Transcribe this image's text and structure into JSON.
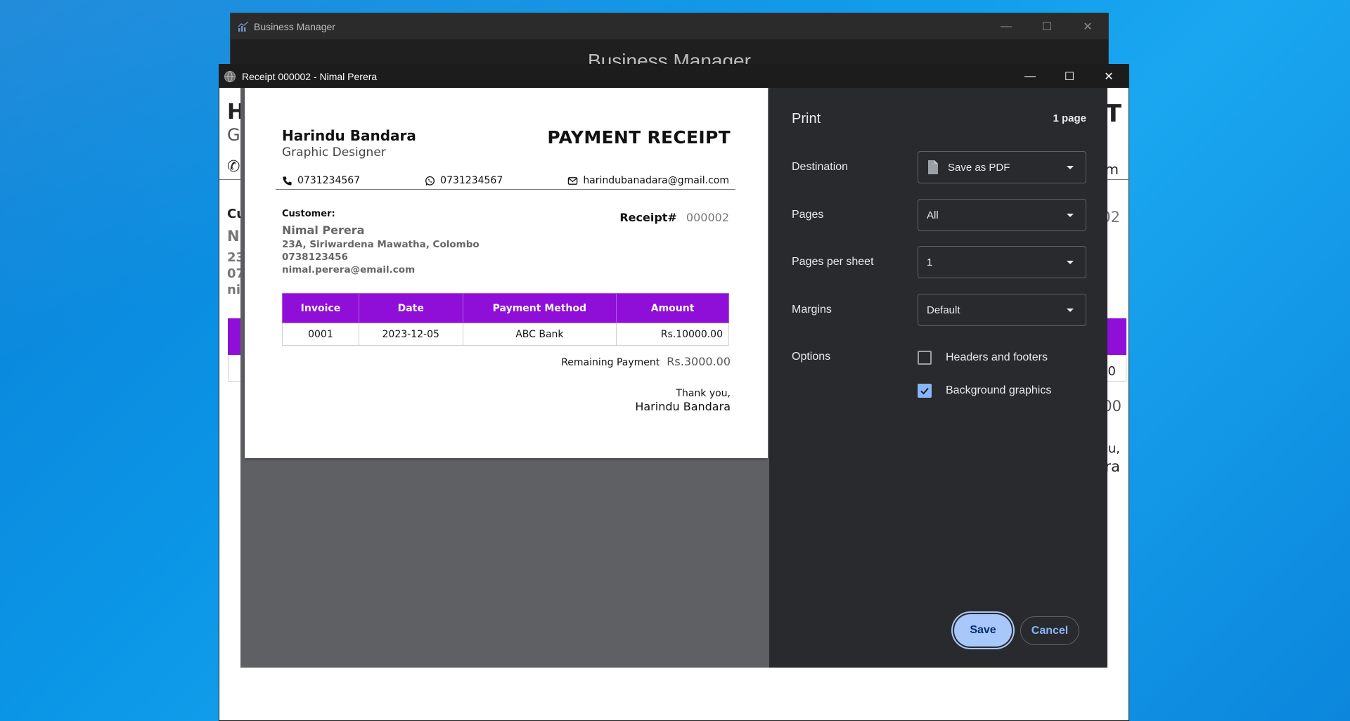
{
  "bm_window": {
    "title": "Business Manager",
    "header_text": "Business Manager"
  },
  "receipt_window": {
    "title": "Receipt 000002 - Nimal Perera",
    "peek": {
      "h": "H",
      "g": "G",
      "cu": "Cu",
      "ni": "Ni",
      "l23": "23",
      "l07": "07",
      "lni": "ni",
      "t": "T",
      "m": "m",
      "n02": "02",
      "n0": "0",
      "n00": "00",
      "u": "u,",
      "ra": "ra"
    }
  },
  "receipt": {
    "name": "Harindu Bandara",
    "role": "Graphic Designer",
    "title": "PAYMENT RECEIPT",
    "phone": "0731234567",
    "whatsapp": "0731234567",
    "email": "harindubanadara@gmail.com",
    "customer_label": "Customer:",
    "customer_name": "Nimal Perera",
    "customer_address": "23A, Siriwardena Mawatha, Colombo",
    "customer_phone": "0738123456",
    "customer_email": "nimal.perera@email.com",
    "receipt_label": "Receipt#",
    "receipt_number": "000002",
    "table_headers": [
      "Invoice",
      "Date",
      "Payment Method",
      "Amount"
    ],
    "table_rows": [
      [
        "0001",
        "2023-12-05",
        "ABC Bank",
        "Rs.10000.00"
      ]
    ],
    "remaining_label": "Remaining Payment",
    "remaining_value": "Rs.3000.00",
    "thanks": "Thank you,",
    "signer": "Harindu Bandara",
    "accent_color": "#8f0fd8"
  },
  "print": {
    "title": "Print",
    "page_count": "1 page",
    "destination_label": "Destination",
    "destination_value": "Save as PDF",
    "pages_label": "Pages",
    "pages_value": "All",
    "pages_per_sheet_label": "Pages per sheet",
    "pages_per_sheet_value": "1",
    "margins_label": "Margins",
    "margins_value": "Default",
    "options_label": "Options",
    "headers_footers_label": "Headers and footers",
    "headers_footers_checked": false,
    "background_graphics_label": "Background graphics",
    "background_graphics_checked": true,
    "save_label": "Save",
    "cancel_label": "Cancel"
  }
}
